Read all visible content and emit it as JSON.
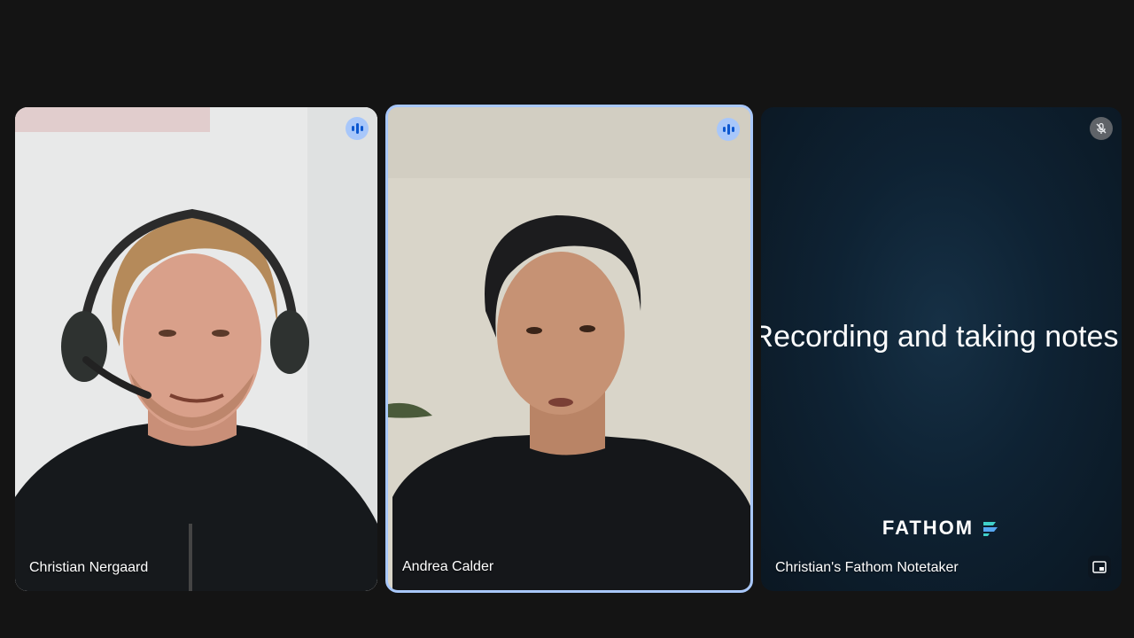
{
  "participants": [
    {
      "name": "Christian Nergaard",
      "status": "speaking"
    },
    {
      "name": "Andrea Calder",
      "status": "speaking",
      "active_speaker": true
    },
    {
      "name": "Christian's Fathom Notetaker",
      "status": "muted"
    }
  ],
  "fathom": {
    "caption": "Recording and taking notes",
    "logo_text": "FATHOM"
  },
  "icons": {
    "speaking": "audio-level-icon",
    "muted": "mic-off-icon",
    "pip": "picture-in-picture-icon"
  },
  "colors": {
    "background": "#141414",
    "active_speaker_border": "#a8c7fa",
    "speaking_badge": "#a8c7fa",
    "fathom_accent": "#3fd0c9"
  }
}
